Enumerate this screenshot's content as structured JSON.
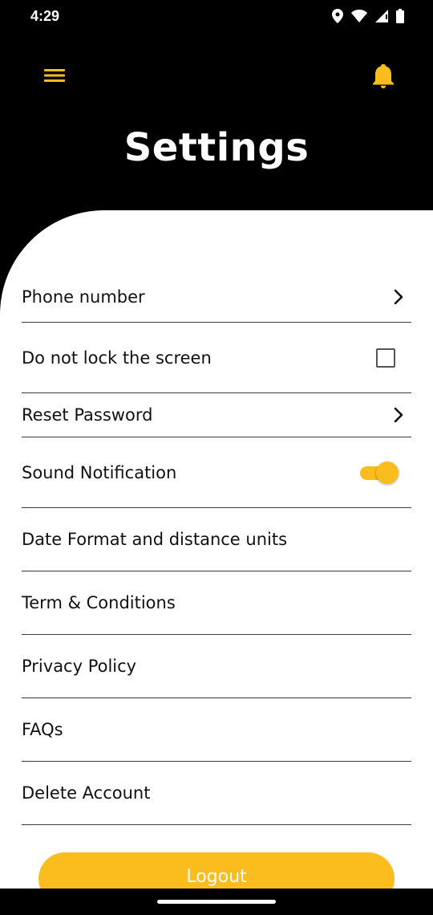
{
  "status_bar": {
    "time": "4:29",
    "icons": [
      "location-icon",
      "wifi-icon",
      "signal-icon",
      "battery-icon"
    ]
  },
  "header": {
    "menu_icon": "hamburger-menu-icon",
    "notification_icon": "bell-icon",
    "title": "Settings"
  },
  "colors": {
    "accent": "#FBBC1E",
    "header_bg": "#000000",
    "sheet_bg": "#FFFFFF",
    "text": "#111111"
  },
  "settings": [
    {
      "label": "Phone number",
      "control": "chevron"
    },
    {
      "label": "Do not lock the screen",
      "control": "checkbox",
      "checked": false
    },
    {
      "label": "Reset Password",
      "control": "chevron"
    },
    {
      "label": "Sound Notification",
      "control": "toggle",
      "on": true
    },
    {
      "label": "Date Format and distance units",
      "control": "none"
    },
    {
      "label": "Term & Conditions",
      "control": "none"
    },
    {
      "label": "Privacy Policy",
      "control": "none"
    },
    {
      "label": "FAQs",
      "control": "none"
    },
    {
      "label": "Delete Account",
      "control": "none"
    }
  ],
  "logout_label": "Logout"
}
